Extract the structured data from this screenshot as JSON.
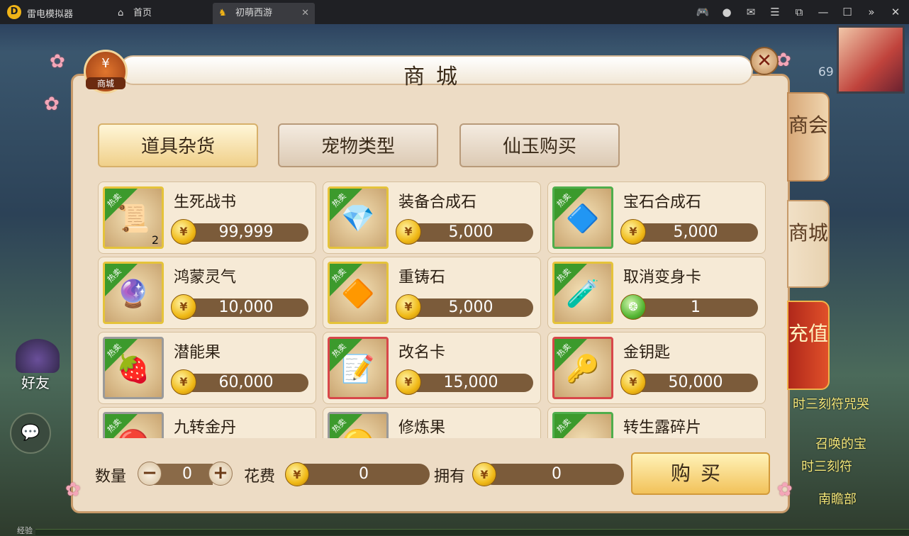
{
  "window": {
    "app_name": "雷电模拟器",
    "tabs": [
      {
        "label": "首页",
        "icon": "home-icon"
      },
      {
        "label": "初萌西游",
        "icon": "game-icon"
      }
    ]
  },
  "hud": {
    "level": "69",
    "friend_label": "好友",
    "exp_label": "经验",
    "scroll_texts": [
      "时三刻符咒哭",
      "召唤的宝",
      "时三刻符",
      "南瞻部"
    ]
  },
  "shop": {
    "title": "商城",
    "badge_glyph": "¥",
    "badge_label": "商城",
    "side_tabs": [
      {
        "label": "商会",
        "selected": false
      },
      {
        "label": "商城",
        "selected": true
      },
      {
        "label": "充值",
        "selected": false
      }
    ],
    "categories": [
      {
        "label": "道具杂货",
        "selected": true
      },
      {
        "label": "宠物类型",
        "selected": false
      },
      {
        "label": "仙玉购买",
        "selected": false
      }
    ],
    "hot_label": "热卖",
    "items": [
      {
        "name": "生死战书",
        "price": "99,999",
        "currency": "gold-coin",
        "frame": "gold",
        "icon": "scroll-icon",
        "qty": "2"
      },
      {
        "name": "装备合成石",
        "price": "5,000",
        "currency": "gold-coin",
        "frame": "gold",
        "icon": "crystal-icon",
        "qty": ""
      },
      {
        "name": "宝石合成石",
        "price": "5,000",
        "currency": "gold-coin",
        "frame": "green",
        "icon": "blue-stone-icon",
        "qty": ""
      },
      {
        "name": "鸿蒙灵气",
        "price": "10,000",
        "currency": "gold-coin",
        "frame": "gold",
        "icon": "orb-icon",
        "qty": ""
      },
      {
        "name": "重铸石",
        "price": "5,000",
        "currency": "gold-coin",
        "frame": "gold",
        "icon": "yellow-crystal-icon",
        "qty": ""
      },
      {
        "name": "取消变身卡",
        "price": "1",
        "currency": "jade-coin",
        "frame": "gold",
        "icon": "potion-icon",
        "qty": ""
      },
      {
        "name": "潜能果",
        "price": "60,000",
        "currency": "gold-coin",
        "frame": "gray",
        "icon": "fruit-icon",
        "qty": ""
      },
      {
        "name": "改名卡",
        "price": "15,000",
        "currency": "gold-coin",
        "frame": "red",
        "icon": "quill-scroll-icon",
        "qty": ""
      },
      {
        "name": "金钥匙",
        "price": "50,000",
        "currency": "gold-coin",
        "frame": "red",
        "icon": "key-icon",
        "qty": ""
      },
      {
        "name": "九转金丹",
        "price": "",
        "currency": "",
        "frame": "gray",
        "icon": "pill-icon",
        "qty": ""
      },
      {
        "name": "修炼果",
        "price": "",
        "currency": "",
        "frame": "gray",
        "icon": "golden-fruit-icon",
        "qty": ""
      },
      {
        "name": "转生露碎片",
        "price": "",
        "currency": "",
        "frame": "green",
        "icon": "fragment-icon",
        "qty": ""
      }
    ],
    "footer": {
      "quantity_label": "数量",
      "quantity_value": "0",
      "cost_label": "花费",
      "cost_value": "0",
      "owned_label": "拥有",
      "owned_value": "0",
      "buy_label": "购买"
    }
  }
}
